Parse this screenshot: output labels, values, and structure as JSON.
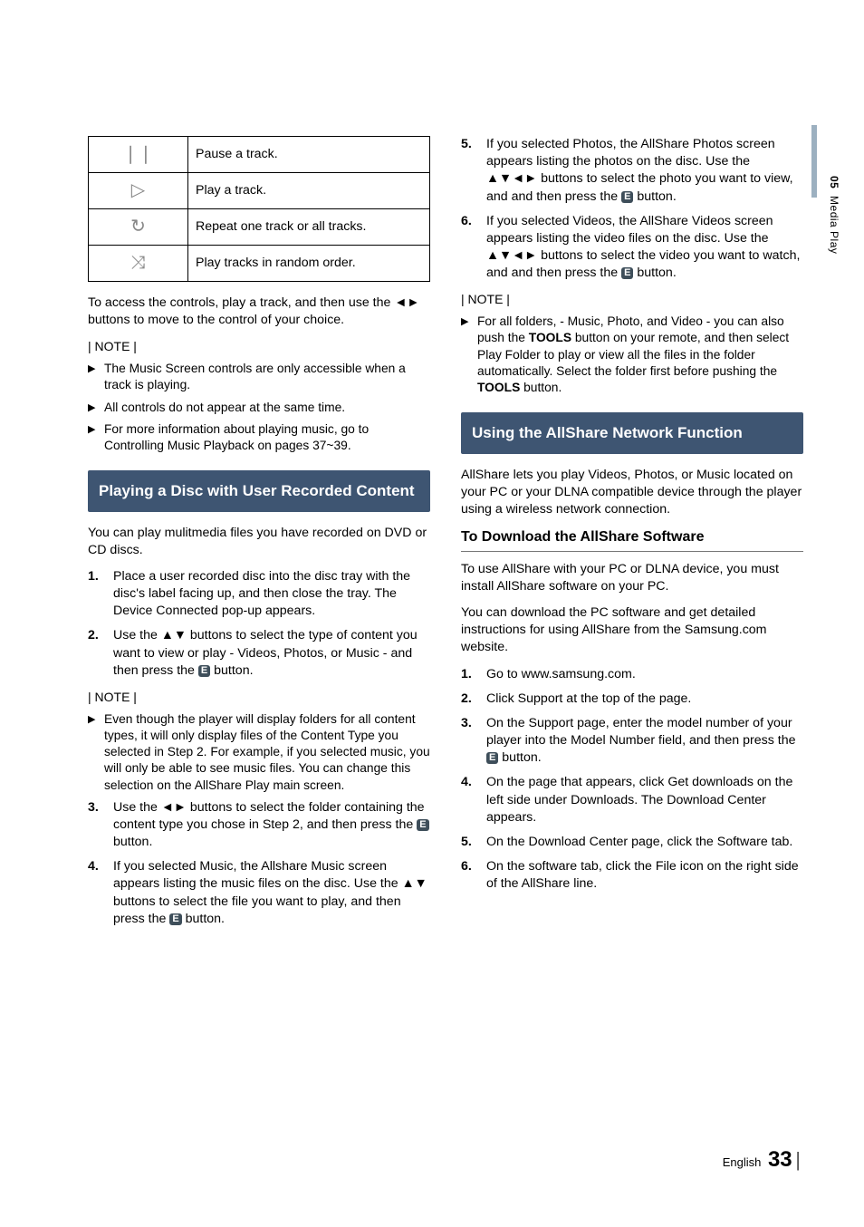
{
  "side": {
    "chapter_num": "05",
    "chapter_title": "Media Play"
  },
  "footer": {
    "lang": "English",
    "page": "33"
  },
  "table": {
    "rows": [
      {
        "icon": "pause-icon",
        "glyph": "❘❘",
        "desc": "Pause a track."
      },
      {
        "icon": "play-icon",
        "glyph": "▷",
        "desc": "Play a track."
      },
      {
        "icon": "repeat-icon",
        "glyph": "↻",
        "desc": "Repeat one track or all tracks."
      },
      {
        "icon": "shuffle-icon",
        "glyph": "⤨",
        "desc": "Play tracks in random order."
      }
    ]
  },
  "left": {
    "intro": "To access the controls, play a track, and then use the ◄► buttons to move to the control of your choice.",
    "note_label": "| NOTE |",
    "notes1": [
      "The Music Screen controls are only accessible when a track is playing.",
      "All controls do not appear at the same time.",
      "For more information about playing music, go to Controlling Music Playback on pages 37~39."
    ],
    "section1": "Playing a Disc with User Recorded Content",
    "para1": "You can play mulitmedia files you have recorded on DVD or CD discs.",
    "steps_a": [
      "Place a user recorded disc into the disc tray with the disc's label facing up, and then close the tray. The Device Connected pop-up appears.",
      "Use the ▲▼ buttons to select the type of content you want to view or play - Videos, Photos, or Music - and then press the {E} button."
    ],
    "note_label2": "| NOTE |",
    "notes2": [
      "Even though the player will display folders for all content types, it will only display files of the Content Type you selected in Step 2. For example, if you selected music, you will only be able to see music files. You can change this selection on the AllShare Play main screen."
    ],
    "steps_b": [
      {
        "n": "3.",
        "t": "Use the ◄► buttons to select the folder containing the content type you chose in Step 2, and then press the {E} button."
      },
      {
        "n": "4.",
        "t": "If you selected Music, the Allshare Music screen appears listing the music files on the disc. Use the ▲▼ buttons to select the file you want to play, and then press the {E} button."
      }
    ]
  },
  "right": {
    "steps_c": [
      {
        "n": "5.",
        "t": "If you selected Photos, the AllShare Photos screen appears listing the photos on the disc. Use the ▲▼◄► buttons to select the photo you want to view, and and then press the {E} button."
      },
      {
        "n": "6.",
        "t": "If you selected Videos, the AllShare Videos screen appears listing the video files on the disc. Use the ▲▼◄► buttons to select the video you want to watch, and and then press the {E} button."
      }
    ],
    "note_label": "| NOTE |",
    "notes": [
      "For all folders, - Music, Photo, and Video - you can also push the {B1} button on your remote, and then select Play Folder to play or view all the files in the folder automatically. Select the folder first before pushing the {B1} button."
    ],
    "tools_word": "TOOLS",
    "section2": "Using the AllShare Network Function",
    "para2": "AllShare lets you play Videos, Photos, or Music located on your PC or your DLNA compatible device through the player using a wireless network connection.",
    "subhead": "To Download the AllShare Software",
    "para3": "To use AllShare with your PC or DLNA device, you must install AllShare software on your PC.",
    "para4": "You can download the PC software and get detailed instructions for using AllShare from the Samsung.com website.",
    "steps_d": [
      "Go to www.samsung.com.",
      "Click Support at the top of the page.",
      "On the Support page, enter the model number of your player into the Model Number field, and then press the {E} button.",
      "On the page that appears, click Get downloads on the left side under Downloads. The Download Center appears.",
      "On the Download Center page, click the Software tab.",
      "On the software tab, click the File icon on the right side of the AllShare line."
    ]
  }
}
